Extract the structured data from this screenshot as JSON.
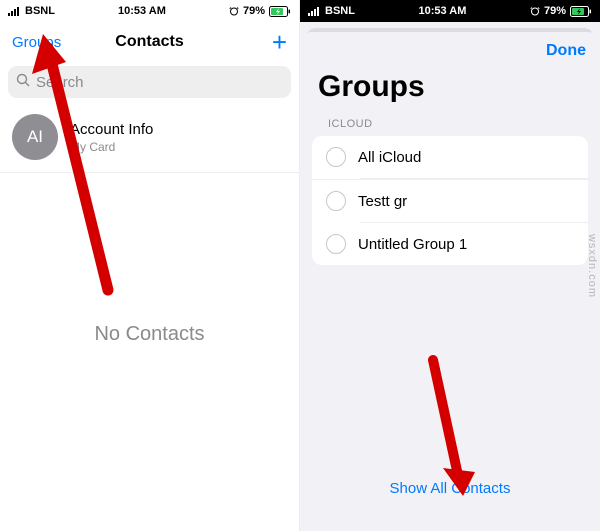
{
  "status": {
    "carrier": "BSNL",
    "time": "10:53 AM",
    "battery": "79%"
  },
  "left": {
    "nav": {
      "groups": "Groups",
      "title": "Contacts"
    },
    "search_placeholder": "Search",
    "me": {
      "initials": "AI",
      "name": "Account Info",
      "sub": "My Card"
    },
    "empty": "No Contacts"
  },
  "right": {
    "done": "Done",
    "title": "Groups",
    "section": "ICLOUD",
    "groups": [
      {
        "label": "All iCloud"
      },
      {
        "label": "Testt gr"
      },
      {
        "label": "Untitled Group 1"
      }
    ],
    "show_all": "Show All Contacts"
  },
  "watermark": "wsxdn.com"
}
